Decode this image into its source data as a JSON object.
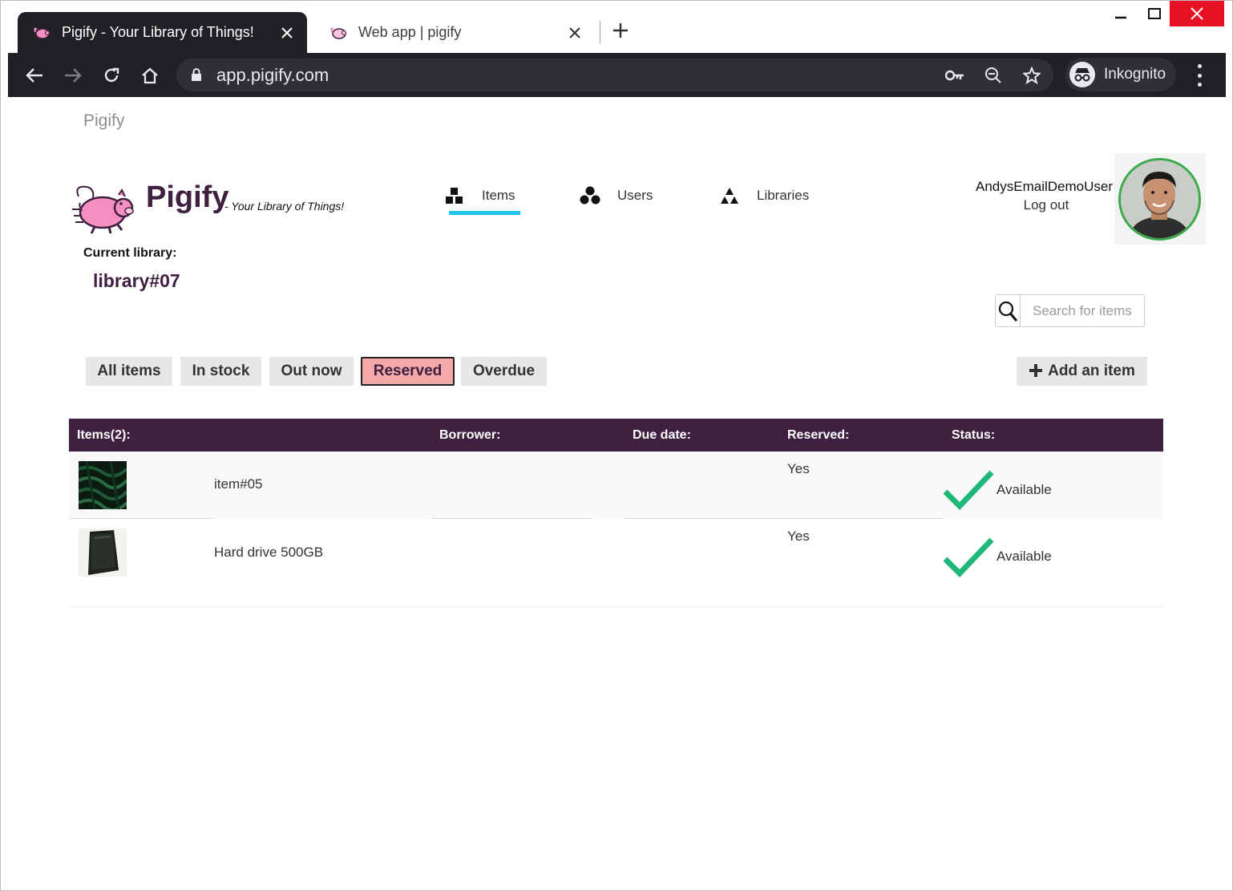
{
  "browser": {
    "tabs": [
      {
        "title": "Pigify - Your Library of Things!",
        "active": true
      },
      {
        "title": "Web app | pigify",
        "active": false
      }
    ],
    "url": "app.pigify.com",
    "incognito_label": "Inkognito",
    "icons": {
      "back": "arrow-left-icon",
      "forward": "arrow-right-icon",
      "reload": "reload-icon",
      "home": "home-icon",
      "lock": "lock-icon",
      "key": "key-icon",
      "zoom": "zoom-out-icon",
      "star": "star-icon",
      "incognito": "incognito-icon",
      "menu": "kebab-menu-icon"
    }
  },
  "app": {
    "brand_small": "Pigify",
    "logo_title": "Pigify",
    "logo_tagline": "- Your Library of Things!",
    "nav": [
      {
        "label": "Items",
        "icon": "boxes-icon",
        "active": true
      },
      {
        "label": "Users",
        "icon": "users-icon",
        "active": false
      },
      {
        "label": "Libraries",
        "icon": "libraries-icon",
        "active": false
      }
    ],
    "user": {
      "name": "AndysEmailDemoUser",
      "logout_label": "Log out"
    },
    "current_library_label": "Current library:",
    "current_library": "library#07",
    "search_placeholder": "Search for items",
    "filters": [
      {
        "label": "All items",
        "active": false
      },
      {
        "label": "In stock",
        "active": false
      },
      {
        "label": "Out now",
        "active": false
      },
      {
        "label": "Reserved",
        "active": true
      },
      {
        "label": "Overdue",
        "active": false
      }
    ],
    "add_button_label": "Add an item",
    "colors": {
      "brand_purple": "#402040",
      "nav_underline": "#1ec4ec",
      "reserved_active": "#f4a8a8",
      "check_green": "#20b77a"
    }
  },
  "table": {
    "headers": {
      "items": "Items(2):",
      "borrower": "Borrower:",
      "due": "Due date:",
      "reserved": "Reserved:",
      "status": "Status:"
    },
    "rows": [
      {
        "name": "item#05",
        "borrower": "",
        "due": "",
        "reserved": "Yes",
        "status": "Available"
      },
      {
        "name": "Hard drive 500GB",
        "borrower": "",
        "due": "",
        "reserved": "Yes",
        "status": "Available"
      }
    ]
  }
}
